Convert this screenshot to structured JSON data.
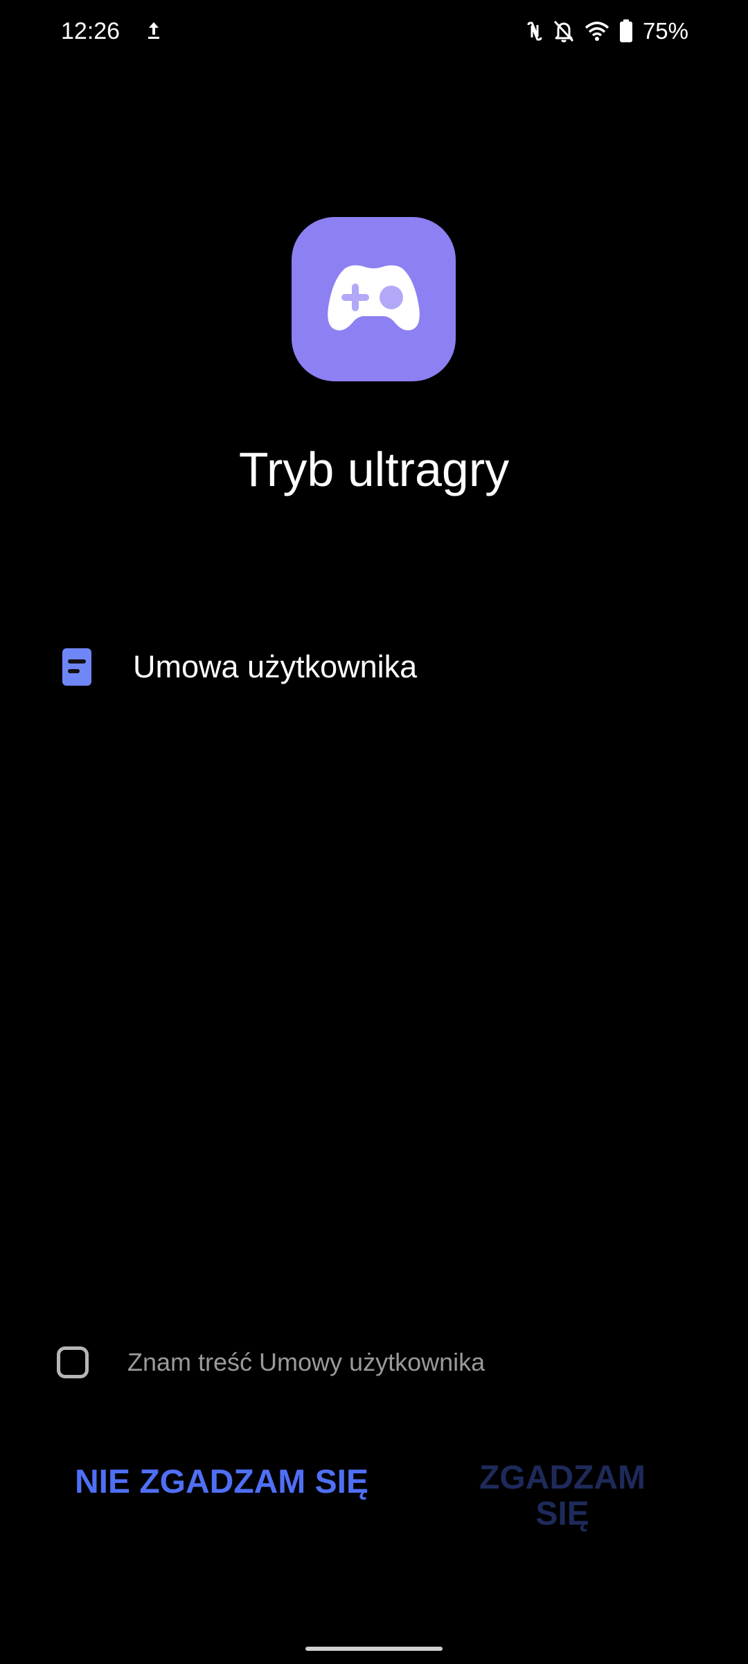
{
  "status_bar": {
    "time": "12:26",
    "battery_percent": "75%",
    "icons": [
      "upload-icon",
      "nfc-icon",
      "bell-off-icon",
      "wifi-icon",
      "battery-icon"
    ]
  },
  "app": {
    "icon": "gamepad-icon",
    "title": "Tryb ultragry",
    "accent_color": "#8d80f2"
  },
  "agreement": {
    "icon": "document-icon",
    "label": "Umowa użytkownika"
  },
  "consent": {
    "checked": false,
    "label": "Znam treść Umowy użytkownika"
  },
  "buttons": {
    "disagree_label": "NIE ZGADZAM SIĘ",
    "agree_label": "ZGADZAM SIĘ",
    "agree_enabled": false
  }
}
